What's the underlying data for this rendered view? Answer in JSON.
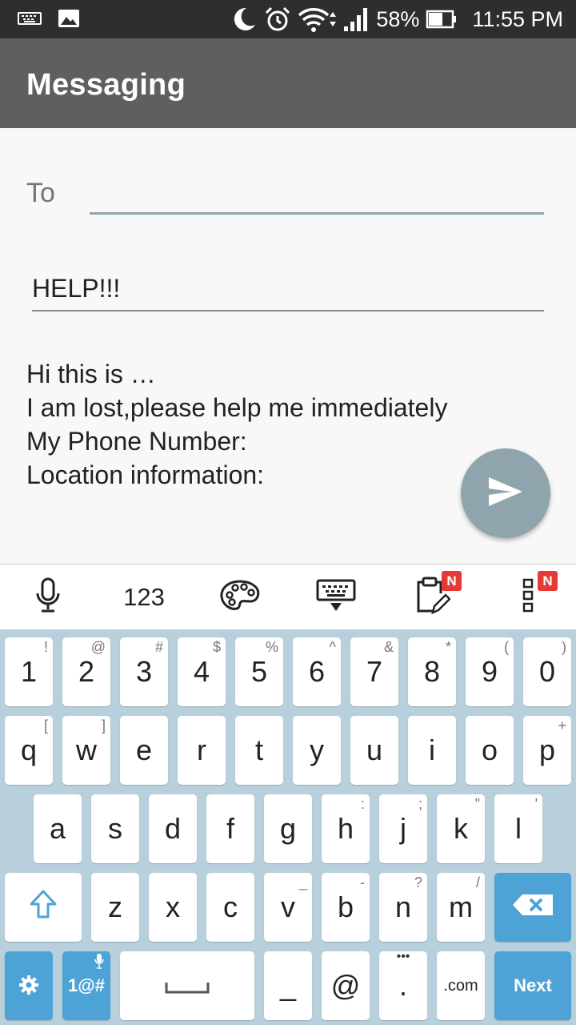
{
  "status_bar": {
    "battery_percent": "58%",
    "time": "11:55 PM",
    "icons": [
      "keyboard-icon",
      "image-icon",
      "moon-icon",
      "alarm-icon",
      "wifi-icon",
      "signal-icon",
      "battery-icon"
    ]
  },
  "app_bar": {
    "title": "Messaging"
  },
  "compose": {
    "to_label": "To",
    "to_value": "",
    "subject": "HELP!!!",
    "body_lines": [
      "Hi this is …",
      "I am lost,please help me immediately",
      "My Phone Number:",
      "Location information:"
    ],
    "send_icon": "send-icon",
    "fab_color": "#90a4ae"
  },
  "keyboard_toolbar": {
    "numbers_label": "123",
    "badge": "N",
    "icons": [
      "microphone-icon",
      "palette-icon",
      "keyboard-hide-icon",
      "clipboard-icon",
      "more-icon"
    ]
  },
  "keyboard": {
    "accent_color": "#4ea3d6",
    "row1": [
      {
        "k": "1",
        "h": "!"
      },
      {
        "k": "2",
        "h": "@"
      },
      {
        "k": "3",
        "h": "#"
      },
      {
        "k": "4",
        "h": "$"
      },
      {
        "k": "5",
        "h": "%"
      },
      {
        "k": "6",
        "h": "^"
      },
      {
        "k": "7",
        "h": "&"
      },
      {
        "k": "8",
        "h": "*"
      },
      {
        "k": "9",
        "h": "("
      },
      {
        "k": "0",
        "h": ")"
      }
    ],
    "row2": [
      {
        "k": "q",
        "h": "["
      },
      {
        "k": "w",
        "h": "]"
      },
      {
        "k": "e",
        "h": ""
      },
      {
        "k": "r",
        "h": ""
      },
      {
        "k": "t",
        "h": ""
      },
      {
        "k": "y",
        "h": ""
      },
      {
        "k": "u",
        "h": ""
      },
      {
        "k": "i",
        "h": ""
      },
      {
        "k": "o",
        "h": ""
      },
      {
        "k": "p",
        "h": "+"
      }
    ],
    "row3": [
      {
        "k": "a",
        "h": ""
      },
      {
        "k": "s",
        "h": ""
      },
      {
        "k": "d",
        "h": ""
      },
      {
        "k": "f",
        "h": ""
      },
      {
        "k": "g",
        "h": ""
      },
      {
        "k": "h",
        "h": ":"
      },
      {
        "k": "j",
        "h": ";"
      },
      {
        "k": "k",
        "h": "\""
      },
      {
        "k": "l",
        "h": "'"
      }
    ],
    "row4": [
      {
        "k": "z",
        "h": ""
      },
      {
        "k": "x",
        "h": ""
      },
      {
        "k": "c",
        "h": ""
      },
      {
        "k": "v",
        "h": "_"
      },
      {
        "k": "b",
        "h": "-"
      },
      {
        "k": "n",
        "h": "?"
      },
      {
        "k": "m",
        "h": "/"
      }
    ],
    "symbols_label": "1@#",
    "underscore_label": "_",
    "at_label": "@",
    "period_label": ".",
    "period_hint": "•••",
    "com_label": ".com",
    "next_label": "Next"
  }
}
